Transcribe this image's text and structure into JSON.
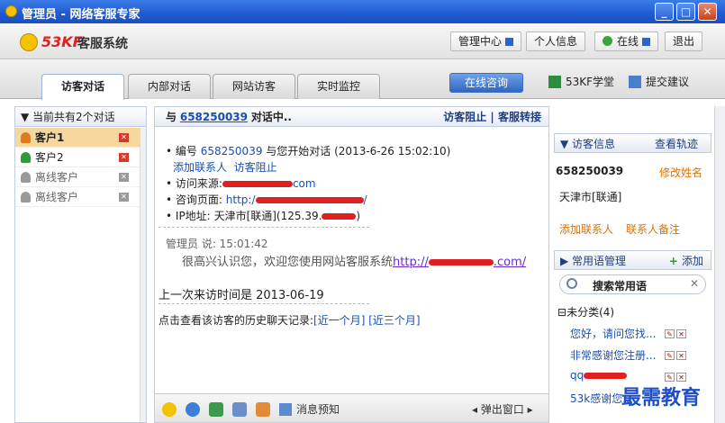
{
  "window": {
    "title": "管理员 - 网络客服专家"
  },
  "app": {
    "brand": "53KF",
    "name": "客服系统",
    "buttons": {
      "manage": "管理中心",
      "profile": "个人信息",
      "status": "在线",
      "exit": "退出"
    }
  },
  "tabs": [
    "访客对话",
    "内部对话",
    "网站访客",
    "实时监控"
  ],
  "toolbar_links": {
    "online_consult": "在线咨询",
    "academy": "53KF学堂",
    "feedback": "提交建议"
  },
  "left_panel": {
    "header": "当前共有2个对话",
    "clients": [
      {
        "label": "客户1",
        "state": "active"
      },
      {
        "label": "客户2",
        "state": "online"
      },
      {
        "label": "离线客户",
        "state": "offline"
      },
      {
        "label": "离线客户",
        "state": "offline"
      }
    ]
  },
  "chat": {
    "header_prefix": "与",
    "visitor_id": "658250039",
    "header_suffix": "对话中..",
    "actions": {
      "block": "访客阻止",
      "transfer": "客服转接",
      "sep": "|"
    },
    "info": {
      "bullet1_prefix": "编号",
      "bullet1_suffix": "与您开始对话 (2013-6-26 15:02:10)",
      "add_contact": "添加联系人",
      "block_visitor": "访客阻止",
      "source_label": "访问来源:",
      "source_tail": "com",
      "page_label": "咨询页面:",
      "page_prefix": "http:/",
      "ip_label": "IP地址:",
      "ip_value": "天津市[联通](125.39.",
      "ip_tail": ")"
    },
    "message": {
      "sender_line": "管理员  说: 15:01:42",
      "text": "很高兴认识您，欢迎您使用网站客服系统",
      "link_prefix": "http://",
      "link_suffix": ".com/"
    },
    "last_visit": "上一次来访时间是  2013-06-19",
    "history_prefix": "点击查看该访客的历史聊天记录:",
    "history_1m": "[近一个月]",
    "history_3m": "[近三个月]",
    "toolbar": {
      "notice": "消息预知",
      "popup": "弹出窗口"
    }
  },
  "visitor_info": {
    "title": "访客信息",
    "track": "查看轨迹",
    "id": "658250039",
    "rename": "修改姓名",
    "location": "天津市[联通]",
    "add_contact": "添加联系人",
    "contact_note": "联系人备注"
  },
  "phrases": {
    "title": "常用语管理",
    "add": "添加",
    "search_placeholder": "搜索常用语",
    "category": "未分类(4)",
    "items": [
      "您好，请问您找...",
      "非常感谢您注册...",
      "qq",
      "53k感谢您..."
    ]
  },
  "watermark": "最需教育",
  "colors": {
    "titlebar": "#1f5ad0",
    "accent_orange": "#e07000",
    "link_blue": "#1a4fb0",
    "close_red": "#d23a2a"
  }
}
